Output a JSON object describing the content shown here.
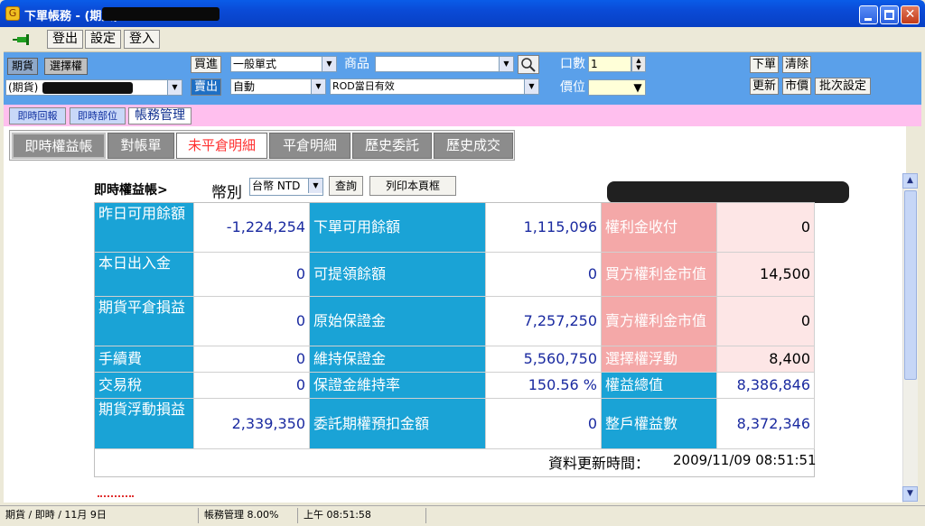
{
  "window": {
    "title": "下單帳務 - (期貨)"
  },
  "toolbar": {
    "logout": "登出",
    "settings": "設定",
    "login": "登入"
  },
  "order": {
    "futures_tag": "期貨",
    "options_tag": "選擇權",
    "account_prefix": "(期貨)",
    "buy_label": "買進",
    "sell_label": "賣出",
    "order_type": "一般單式",
    "mode": "自動",
    "product_label": "商品",
    "product_value": "",
    "condition": "ROD當日有效",
    "qty_label": "口數",
    "qty_value": "1",
    "price_label": "價位",
    "price_value": "",
    "place_order": "下單",
    "clear": "清除",
    "update": "更新",
    "market_price": "市價",
    "batch_setting": "批次設定"
  },
  "tabs": {
    "realtime_report": "即時回報",
    "realtime_position": "即時部位",
    "ledger": "帳務管理"
  },
  "subtabs": [
    "即時權益帳",
    "對帳單",
    "未平倉明細",
    "平倉明細",
    "歷史委託",
    "歷史成交"
  ],
  "ledger": {
    "header_title": "即時權益帳>",
    "currency_label": "幣別",
    "currency_value": "台幣 NTD",
    "query_btn": "查詢",
    "print_btn": "列印本頁框",
    "rows": [
      {
        "l1": "昨日可用餘額",
        "v1": "-1,224,254",
        "l2": "下單可用餘額",
        "v2": "1,115,096",
        "l3": "權利金收付",
        "v3": "0"
      },
      {
        "l1": "本日出入金",
        "v1": "0",
        "l2": "可提領餘額",
        "v2": "0",
        "l3": "買方權利金市值",
        "v3": "14,500"
      },
      {
        "l1": "期貨平倉損益",
        "v1": "0",
        "l2": "原始保證金",
        "v2": "7,257,250",
        "l3": "賣方權利金市值",
        "v3": "0"
      },
      {
        "l1": "手續費",
        "v1": "0",
        "l2": "維持保證金",
        "v2": "5,560,750",
        "l3": "選擇權浮動",
        "v3": "8,400"
      },
      {
        "l1": "交易稅",
        "v1": "0",
        "l2": "保證金維持率",
        "v2": "150.56 %",
        "l3": "權益總值",
        "v3": "8,386,846"
      },
      {
        "l1": "期貨浮動損益",
        "v1": "2,339,350",
        "l2": "委託期權預扣金額",
        "v2": "0",
        "l3": "整戶權益數",
        "v3": "8,372,346"
      }
    ],
    "update_label": "資料更新時間：",
    "update_time": "2009/11/09 08:51:51"
  },
  "status": {
    "left": "期貨 / 即時 / 11月 9日",
    "middle": "帳務管理  8.00%",
    "right": "上午 08:51:58"
  },
  "colors": {
    "accent_blue": "#1aa3d6",
    "accent_pink": "#f4a8a8",
    "tab_pink": "#ffbfee",
    "order_bar": "#5aa0ea"
  }
}
